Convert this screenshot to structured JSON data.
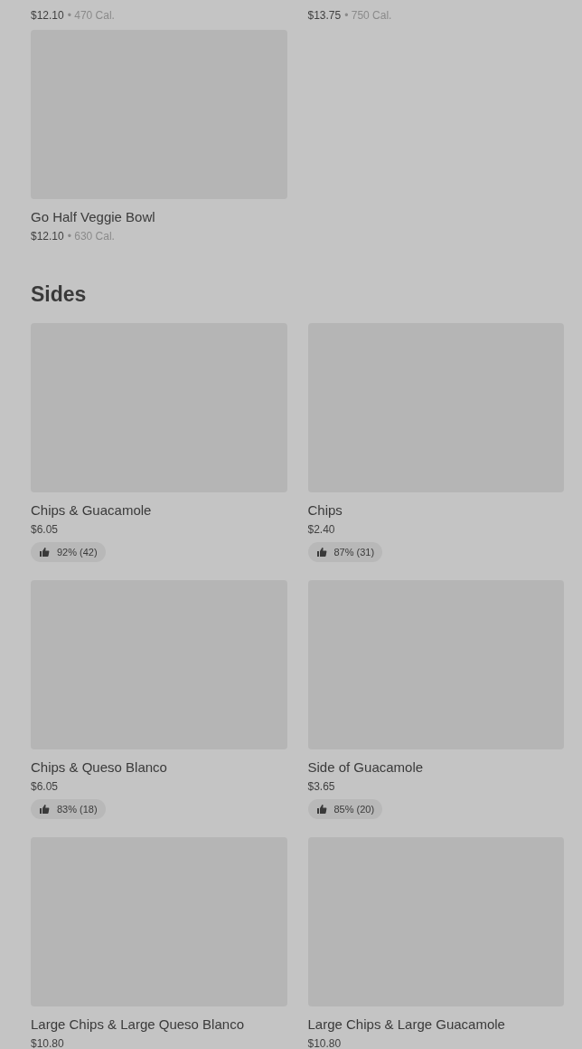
{
  "previous_row": [
    {
      "price": "$12.10",
      "calories": "• 470 Cal."
    },
    {
      "price": "$13.75",
      "calories": "• 750 Cal."
    }
  ],
  "bowls": [
    {
      "name": "Go Half Veggie Bowl",
      "price": "$12.10",
      "calories": "• 630 Cal."
    }
  ],
  "sides": {
    "title": "Sides",
    "items": [
      {
        "name": "Chips & Guacamole",
        "price": "$6.05",
        "rating": "92% (42)"
      },
      {
        "name": "Chips",
        "price": "$2.40",
        "rating": "87% (31)"
      },
      {
        "name": "Chips & Queso Blanco",
        "price": "$6.05",
        "rating": "83% (18)"
      },
      {
        "name": "Side of Guacamole",
        "price": "$3.65",
        "rating": "85% (20)"
      },
      {
        "name": "Large Chips & Large Queso Blanco",
        "price": "$10.80"
      },
      {
        "name": "Large Chips & Large Guacamole",
        "price": "$10.80"
      }
    ]
  }
}
